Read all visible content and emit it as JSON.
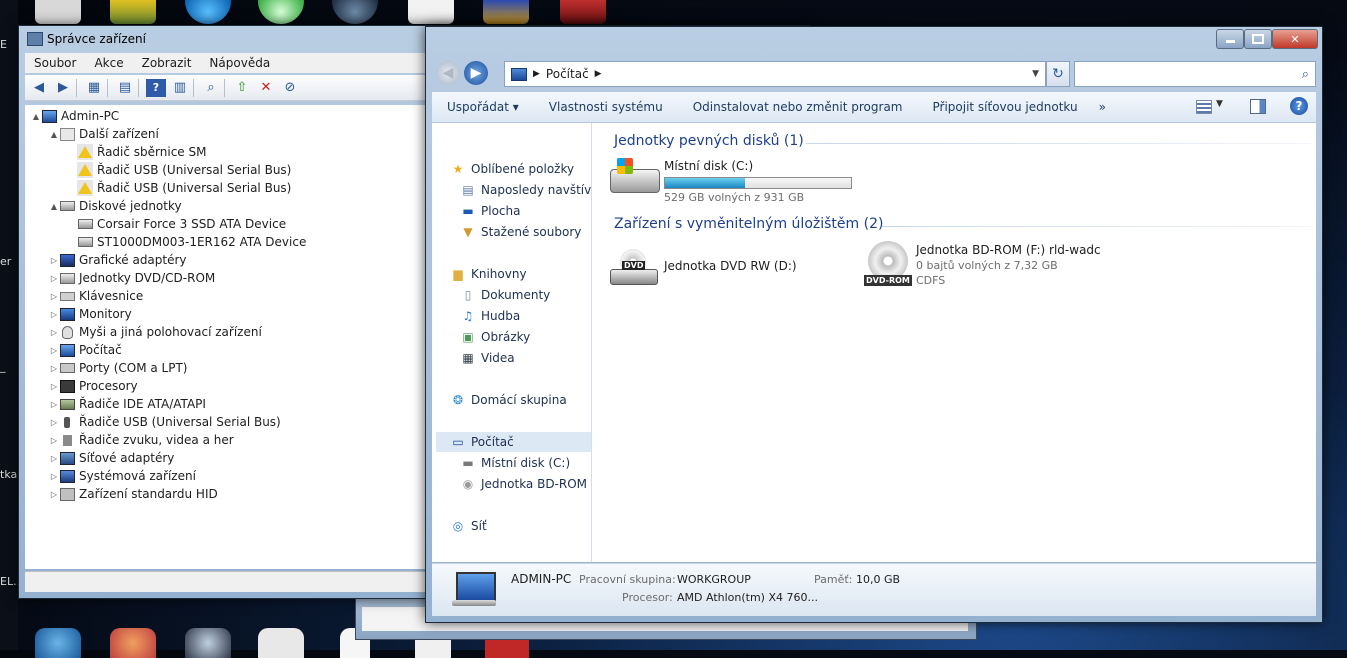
{
  "desktop": {
    "side_labels": [
      "E",
      "er",
      "_",
      "tka",
      "EL.."
    ]
  },
  "device_manager": {
    "title": "Správce zařízení",
    "menu": [
      "Soubor",
      "Akce",
      "Zobrazit",
      "Nápověda"
    ],
    "tree": [
      {
        "label": "Admin-PC",
        "level": 0,
        "icon": "computer-icon",
        "expander": "▲"
      },
      {
        "label": "Další zařízení",
        "level": 1,
        "icon": "unknown-device-icon",
        "expander": "▲"
      },
      {
        "label": "Řadič sběrnice SM",
        "level": 2,
        "icon": "warning-icon",
        "expander": ""
      },
      {
        "label": "Řadič USB (Universal Serial Bus)",
        "level": 2,
        "icon": "warning-icon",
        "expander": ""
      },
      {
        "label": "Řadič USB (Universal Serial Bus)",
        "level": 2,
        "icon": "warning-icon",
        "expander": ""
      },
      {
        "label": "Diskové jednotky",
        "level": 1,
        "icon": "disk-drive-icon",
        "expander": "▲"
      },
      {
        "label": "Corsair Force 3 SSD ATA Device",
        "level": 2,
        "icon": "disk-drive-icon",
        "expander": ""
      },
      {
        "label": "ST1000DM003-1ER162 ATA Device",
        "level": 2,
        "icon": "disk-drive-icon",
        "expander": ""
      },
      {
        "label": "Grafické adaptéry",
        "level": 1,
        "icon": "display-adapter-icon",
        "expander": "▷"
      },
      {
        "label": "Jednotky DVD/CD-ROM",
        "level": 1,
        "icon": "dvd-drive-icon",
        "expander": "▷"
      },
      {
        "label": "Klávesnice",
        "level": 1,
        "icon": "keyboard-icon",
        "expander": "▷"
      },
      {
        "label": "Monitory",
        "level": 1,
        "icon": "monitor-icon",
        "expander": "▷"
      },
      {
        "label": "Myši a jiná polohovací zařízení",
        "level": 1,
        "icon": "mouse-icon",
        "expander": "▷"
      },
      {
        "label": "Počítač",
        "level": 1,
        "icon": "computer-icon",
        "expander": "▷"
      },
      {
        "label": "Porty (COM a LPT)",
        "level": 1,
        "icon": "port-icon",
        "expander": "▷"
      },
      {
        "label": "Procesory",
        "level": 1,
        "icon": "processor-icon",
        "expander": "▷"
      },
      {
        "label": "Řadiče IDE ATA/ATAPI",
        "level": 1,
        "icon": "ide-controller-icon",
        "expander": "▷"
      },
      {
        "label": "Řadiče USB (Universal Serial Bus)",
        "level": 1,
        "icon": "usb-icon",
        "expander": "▷"
      },
      {
        "label": "Řadiče zvuku, videa a her",
        "level": 1,
        "icon": "speaker-icon",
        "expander": "▷"
      },
      {
        "label": "Síťové adaptéry",
        "level": 1,
        "icon": "network-adapter-icon",
        "expander": "▷"
      },
      {
        "label": "Systémová zařízení",
        "level": 1,
        "icon": "system-device-icon",
        "expander": "▷"
      },
      {
        "label": "Zařízení standardu HID",
        "level": 1,
        "icon": "hid-icon",
        "expander": "▷"
      }
    ]
  },
  "explorer": {
    "breadcrumb": [
      "Počítač"
    ],
    "search_placeholder": "",
    "commands": [
      "Uspořádat ▾",
      "Vlastnosti systému",
      "Odinstalovat nebo změnit program",
      "Připojit síťovou jednotku",
      "»"
    ],
    "nav": [
      {
        "label": "Oblíbené položky",
        "icon": "star-icon",
        "indent": 0,
        "selected": false
      },
      {
        "label": "Naposledy navštívené",
        "icon": "recent-places-icon",
        "indent": 1,
        "selected": false
      },
      {
        "label": "Plocha",
        "icon": "desktop-icon",
        "indent": 1,
        "selected": false
      },
      {
        "label": "Stažené soubory",
        "icon": "downloads-icon",
        "indent": 1,
        "selected": false
      },
      {
        "label": "Knihovny",
        "icon": "libraries-icon",
        "indent": 0,
        "selected": false
      },
      {
        "label": "Dokumenty",
        "icon": "documents-icon",
        "indent": 1,
        "selected": false
      },
      {
        "label": "Hudba",
        "icon": "music-icon",
        "indent": 1,
        "selected": false
      },
      {
        "label": "Obrázky",
        "icon": "pictures-icon",
        "indent": 1,
        "selected": false
      },
      {
        "label": "Videa",
        "icon": "videos-icon",
        "indent": 1,
        "selected": false
      },
      {
        "label": "Domácí skupina",
        "icon": "homegroup-icon",
        "indent": 0,
        "selected": false
      },
      {
        "label": "Počítač",
        "icon": "computer-icon",
        "indent": 0,
        "selected": true
      },
      {
        "label": "Místní disk (C:)",
        "icon": "local-disk-icon",
        "indent": 1,
        "selected": false
      },
      {
        "label": "Jednotka BD-ROM (F:) rld-wadc",
        "icon": "bd-rom-icon",
        "indent": 1,
        "selected": false
      },
      {
        "label": "Síť",
        "icon": "network-icon",
        "indent": 0,
        "selected": false
      }
    ],
    "groups": {
      "hard_disks": {
        "title": "Jednotky pevných disků (1)",
        "drive_name": "Místní disk (C:)",
        "drive_free": "529 GB volných z 931 GB",
        "used_fraction": 0.43
      },
      "removable": {
        "title": "Zařízení s vyměnitelným úložištěm (2)",
        "dvd_name": "Jednotka DVD RW (D:)",
        "dvd_badge": "DVD",
        "bd_name": "Jednotka BD-ROM (F:) rld-wadc",
        "bd_free": "0 bajtů volných z 7,32 GB",
        "bd_fs": "CDFS",
        "bd_badge": "DVD-ROM"
      }
    },
    "details": {
      "computer_name": "ADMIN-PC",
      "workgroup_label": "Pracovní skupina:",
      "workgroup_value": "WORKGROUP",
      "memory_label": "Paměť:",
      "memory_value": "10,0 GB",
      "processor_label": "Procesor:",
      "processor_value": "AMD Athlon(tm) X4 760..."
    }
  },
  "colors": {
    "accent": "#1e3f8a",
    "progress_fill": "#2a9ad6",
    "selection": "#dde8f5"
  }
}
